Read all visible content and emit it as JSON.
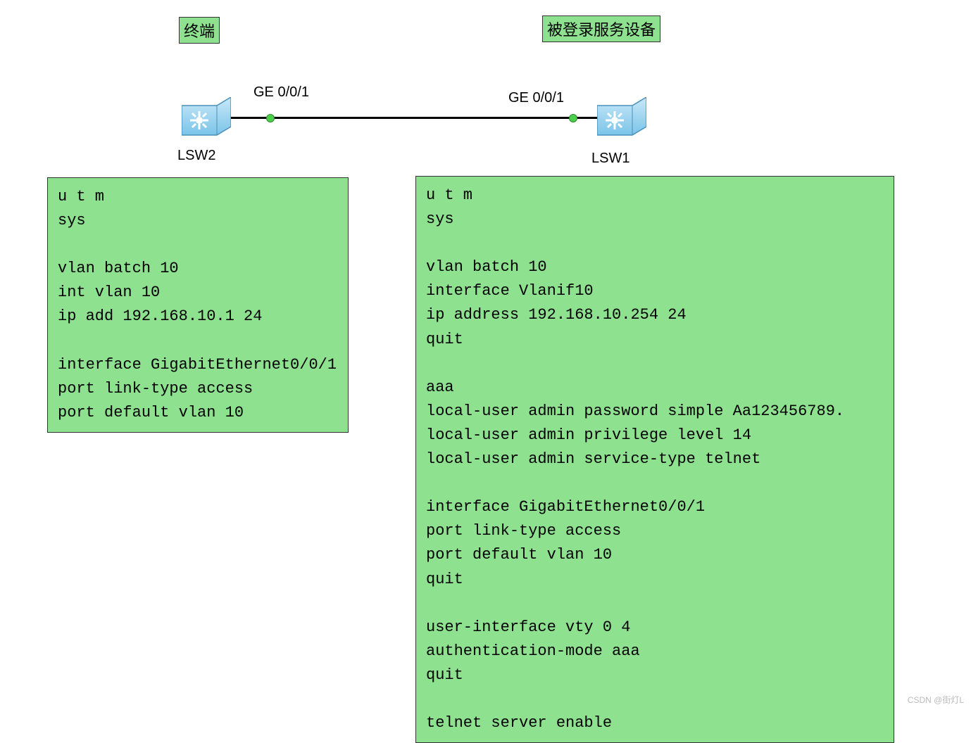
{
  "labels": {
    "terminal": "终端",
    "server": "被登录服务设备",
    "port_left": "GE 0/0/1",
    "port_right": "GE 0/0/1",
    "device_left": "LSW2",
    "device_right": "LSW1",
    "watermark": "CSDN @街灯L"
  },
  "configs": {
    "lsw2": "u t m\nsys\n\nvlan batch 10\nint vlan 10\nip add 192.168.10.1 24\n\ninterface GigabitEthernet0/0/1\nport link-type access\nport default vlan 10",
    "lsw1": "u t m\nsys\n\nvlan batch 10\ninterface Vlanif10\nip address 192.168.10.254 24\nquit\n\naaa\nlocal-user admin password simple Aa123456789.\nlocal-user admin privilege level 14\nlocal-user admin service-type telnet\n\ninterface GigabitEthernet0/0/1\nport link-type access\nport default vlan 10\nquit\n\nuser-interface vty 0 4\nauthentication-mode aaa\nquit\n\ntelnet server enable"
  }
}
